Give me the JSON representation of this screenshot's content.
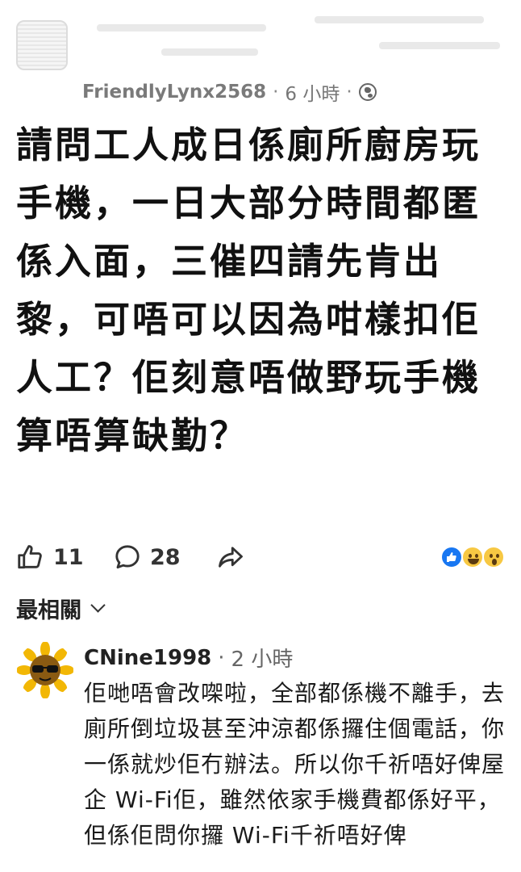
{
  "post": {
    "author": "FriendlyLynx2568",
    "separator": "·",
    "time": "6 小時",
    "title": "請問工人成日係廁所廚房玩手機，一日大部分時間都匿係入面，三催四請先肯出黎，可唔可以因為咁樣扣佢人工？佢刻意唔做野玩手機算唔算缺勤？",
    "likes": "11",
    "comments": "28",
    "icons": {
      "visibility": "globe-icon",
      "like": "thumbs-up-icon",
      "comment": "comment-bubble-icon",
      "share": "share-arrow-icon",
      "reactions": [
        "like-reaction-icon",
        "haha-reaction-icon",
        "wow-reaction-icon"
      ]
    }
  },
  "sort": {
    "label": "最相關",
    "icon": "chevron-down-icon"
  },
  "comment": {
    "author": "CNine1998",
    "separator": "·",
    "time": "2 小時",
    "body": "佢哋唔會改㗎啦，全部都係機不離手，去廁所倒垃圾甚至沖涼都係攞住個電話，你一係就炒佢冇辦法。所以你千祈唔好俾屋企 Wi-Fi佢，雖然依家手機費都係好平，但係佢問你攞 Wi-Fi千祈唔好俾",
    "avatar_icon": "sunflower-sunglasses-avatar"
  },
  "colors": {
    "background": "#ffffff",
    "text": "#111111",
    "meta": "#7a7a7a",
    "like_blue": "#1877f2",
    "reaction_yellow": "#f7c843"
  }
}
